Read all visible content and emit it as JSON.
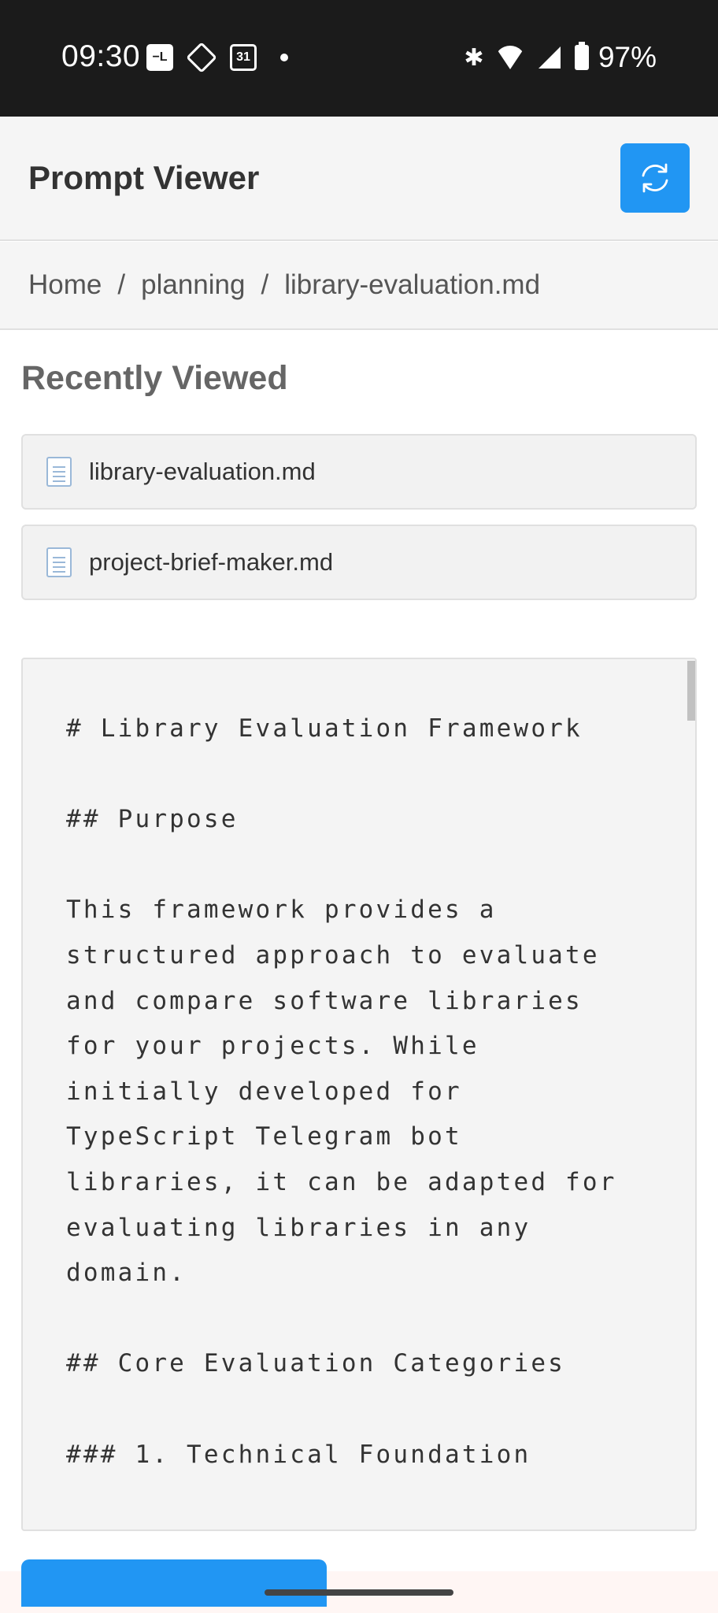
{
  "status_bar": {
    "time": "09:30",
    "calendar_day": "31",
    "battery": "97%",
    "icons": [
      "notification-box-icon",
      "diamond-app-icon",
      "calendar-icon",
      "dot-icon",
      "bluetooth-icon",
      "wifi-icon",
      "signal-icon",
      "battery-icon"
    ]
  },
  "header": {
    "title": "Prompt Viewer",
    "refresh_icon": "refresh-icon",
    "accent_color": "#2196f3"
  },
  "breadcrumb": {
    "items": [
      "Home",
      "planning",
      "library-evaluation.md"
    ],
    "separator": "/"
  },
  "recent": {
    "title": "Recently Viewed",
    "items": [
      {
        "name": "library-evaluation.md",
        "icon": "document-icon"
      },
      {
        "name": "project-brief-maker.md",
        "icon": "document-icon"
      }
    ]
  },
  "content": {
    "text": "# Library Evaluation Framework\n\n## Purpose\n\nThis framework provides a\nstructured approach to evaluate\nand compare software libraries\nfor your projects. While\ninitially developed for\nTypeScript Telegram bot\nlibraries, it can be adapted for\nevaluating libraries in any\ndomain.\n\n## Core Evaluation Categories\n\n### 1. Technical Foundation"
  }
}
